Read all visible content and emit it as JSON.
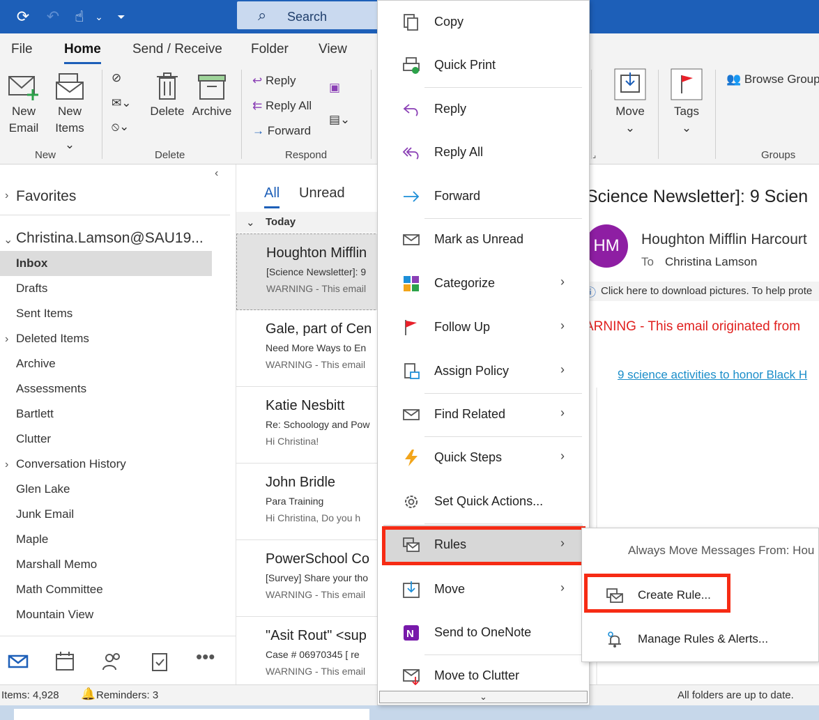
{
  "titlebar": {
    "search_label": "Search"
  },
  "tabs": [
    "File",
    "Home",
    "Send / Receive",
    "Folder",
    "View"
  ],
  "ribbon": {
    "new_email": [
      "New",
      "Email"
    ],
    "new_items": [
      "New",
      "Items ⌄"
    ],
    "delete": "Delete",
    "archive": "Archive",
    "reply": "Reply",
    "reply_all": "Reply All",
    "forward": "Forward",
    "move": "Move",
    "tags": "Tags",
    "browse_groups": "Browse Groups",
    "groups": {
      "new": "New",
      "delete": "Delete",
      "respond": "Respond",
      "groups": "Groups"
    }
  },
  "folders": {
    "favorites": "Favorites",
    "account": "Christina.Lamson@SAU19...",
    "items": [
      "Inbox",
      "Drafts",
      "Sent Items",
      "Deleted Items",
      "Archive",
      "Assessments",
      "Bartlett",
      "Clutter",
      "Conversation History",
      "Glen Lake",
      "Junk Email",
      "Maple",
      "Marshall Memo",
      "Math Committee",
      "Mountain View"
    ]
  },
  "msglist": {
    "tab_all": "All",
    "tab_unread": "Unread",
    "today": "Today",
    "messages": [
      {
        "from": "Houghton Mifflin",
        "subj": "[Science Newsletter]: 9",
        "prev": "WARNING - This email"
      },
      {
        "from": "Gale, part of Cen",
        "subj": "Need More Ways to En",
        "prev": "WARNING - This email"
      },
      {
        "from": "Katie Nesbitt",
        "subj": "Re: Schoology and Pow",
        "prev": "Hi Christina!"
      },
      {
        "from": "John Bridle",
        "subj": "Para Training",
        "prev": "Hi Christina,   Do you h"
      },
      {
        "from": "PowerSchool Co",
        "subj": "[Survey] Share your tho",
        "prev": "WARNING - This email"
      },
      {
        "from": "\"Asit Rout\" <sup",
        "subj": "Case # 06970345    [ re",
        "prev": "WARNING - This email"
      }
    ]
  },
  "reading": {
    "title": "Science Newsletter]: 9 Scien",
    "avatar": "HM",
    "from": "Houghton Mifflin Harcourt",
    "to_label": "To",
    "to": "Christina Lamson",
    "info": "Click here to download pictures. To help prote",
    "warning": "ARNING - This email originated from",
    "link": "9 science activities to honor Black H"
  },
  "context_menu": {
    "items": [
      {
        "label": "Copy",
        "icon": "copy-icon"
      },
      {
        "label": "Quick Print",
        "icon": "print-icon"
      },
      {
        "label": "Reply",
        "icon": "reply-icon"
      },
      {
        "label": "Reply All",
        "icon": "reply-all-icon"
      },
      {
        "label": "Forward",
        "icon": "forward-icon"
      },
      {
        "label": "Mark as Unread",
        "icon": "envelope-icon"
      },
      {
        "label": "Categorize",
        "icon": "categorize-icon"
      },
      {
        "label": "Follow Up",
        "icon": "flag-icon"
      },
      {
        "label": "Assign Policy",
        "icon": "policy-icon"
      },
      {
        "label": "Find Related",
        "icon": "find-related-icon"
      },
      {
        "label": "Quick Steps",
        "icon": "lightning-icon"
      },
      {
        "label": "Set Quick Actions...",
        "icon": "gear-icon"
      },
      {
        "label": "Rules",
        "icon": "rules-icon"
      },
      {
        "label": "Move",
        "icon": "move-icon"
      },
      {
        "label": "Send to OneNote",
        "icon": "onenote-icon"
      },
      {
        "label": "Move to Clutter",
        "icon": "clutter-icon"
      }
    ]
  },
  "submenu": {
    "header": "Always Move Messages From: Hou",
    "create_rule": "Create Rule...",
    "manage_rules": "Manage Rules & Alerts..."
  },
  "statusbar": {
    "items": "Items: 4,928",
    "reminders": "Reminders: 3",
    "sync": "All folders are up to date."
  },
  "colors": {
    "accent": "#1d5fb8",
    "highlight_box": "#f62b14",
    "avatar": "#8e1ea3",
    "warning": "#e0201e",
    "link": "#1a8dc9"
  }
}
